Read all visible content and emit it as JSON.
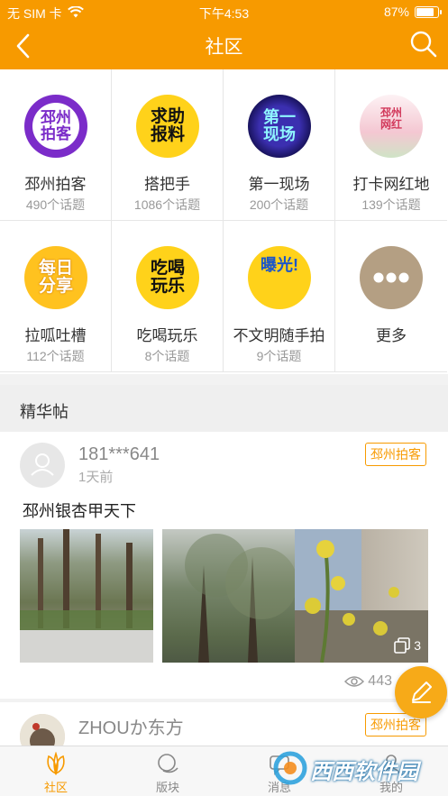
{
  "status_bar": {
    "carrier": "无 SIM 卡",
    "time": "下午4:53",
    "battery": "87%",
    "battery_level": 0.87
  },
  "nav": {
    "title": "社区"
  },
  "categories": [
    {
      "name": "邳州拍客",
      "count": "490个话题",
      "icon_text": "邳州拍客"
    },
    {
      "name": "搭把手",
      "count": "1086个话题",
      "icon_text": "求助报料"
    },
    {
      "name": "第一现场",
      "count": "200个话题",
      "icon_text": "第一现场"
    },
    {
      "name": "打卡网红地",
      "count": "139个话题",
      "icon_text": "邳州网红"
    },
    {
      "name": "拉呱吐槽",
      "count": "112个话题",
      "icon_text": "每日分享"
    },
    {
      "name": "吃喝玩乐",
      "count": "8个话题",
      "icon_text": "吃喝玩乐"
    },
    {
      "name": "不文明随手拍",
      "count": "9个话题",
      "icon_text": "曝光!"
    },
    {
      "name": "更多",
      "count": "",
      "icon_text": ""
    }
  ],
  "section": {
    "title": "精华帖"
  },
  "post": {
    "user": "181***641",
    "time": "1天前",
    "tag": "邳州拍客",
    "title": "邳州银杏甲天下",
    "more_photos": "3",
    "views": "443"
  },
  "post2": {
    "user": "ZHOUか东方",
    "tag": "邳州拍客"
  },
  "tabs": [
    {
      "label": "社区",
      "icon": "community-icon"
    },
    {
      "label": "版块",
      "icon": "board-icon"
    },
    {
      "label": "消息",
      "icon": "message-icon"
    },
    {
      "label": "我的",
      "icon": "profile-icon"
    }
  ],
  "colors": {
    "accent": "#f79a00",
    "fab": "#f7aa18",
    "more_circle": "#b49f83"
  },
  "watermark": {
    "text": "西西软件园"
  }
}
